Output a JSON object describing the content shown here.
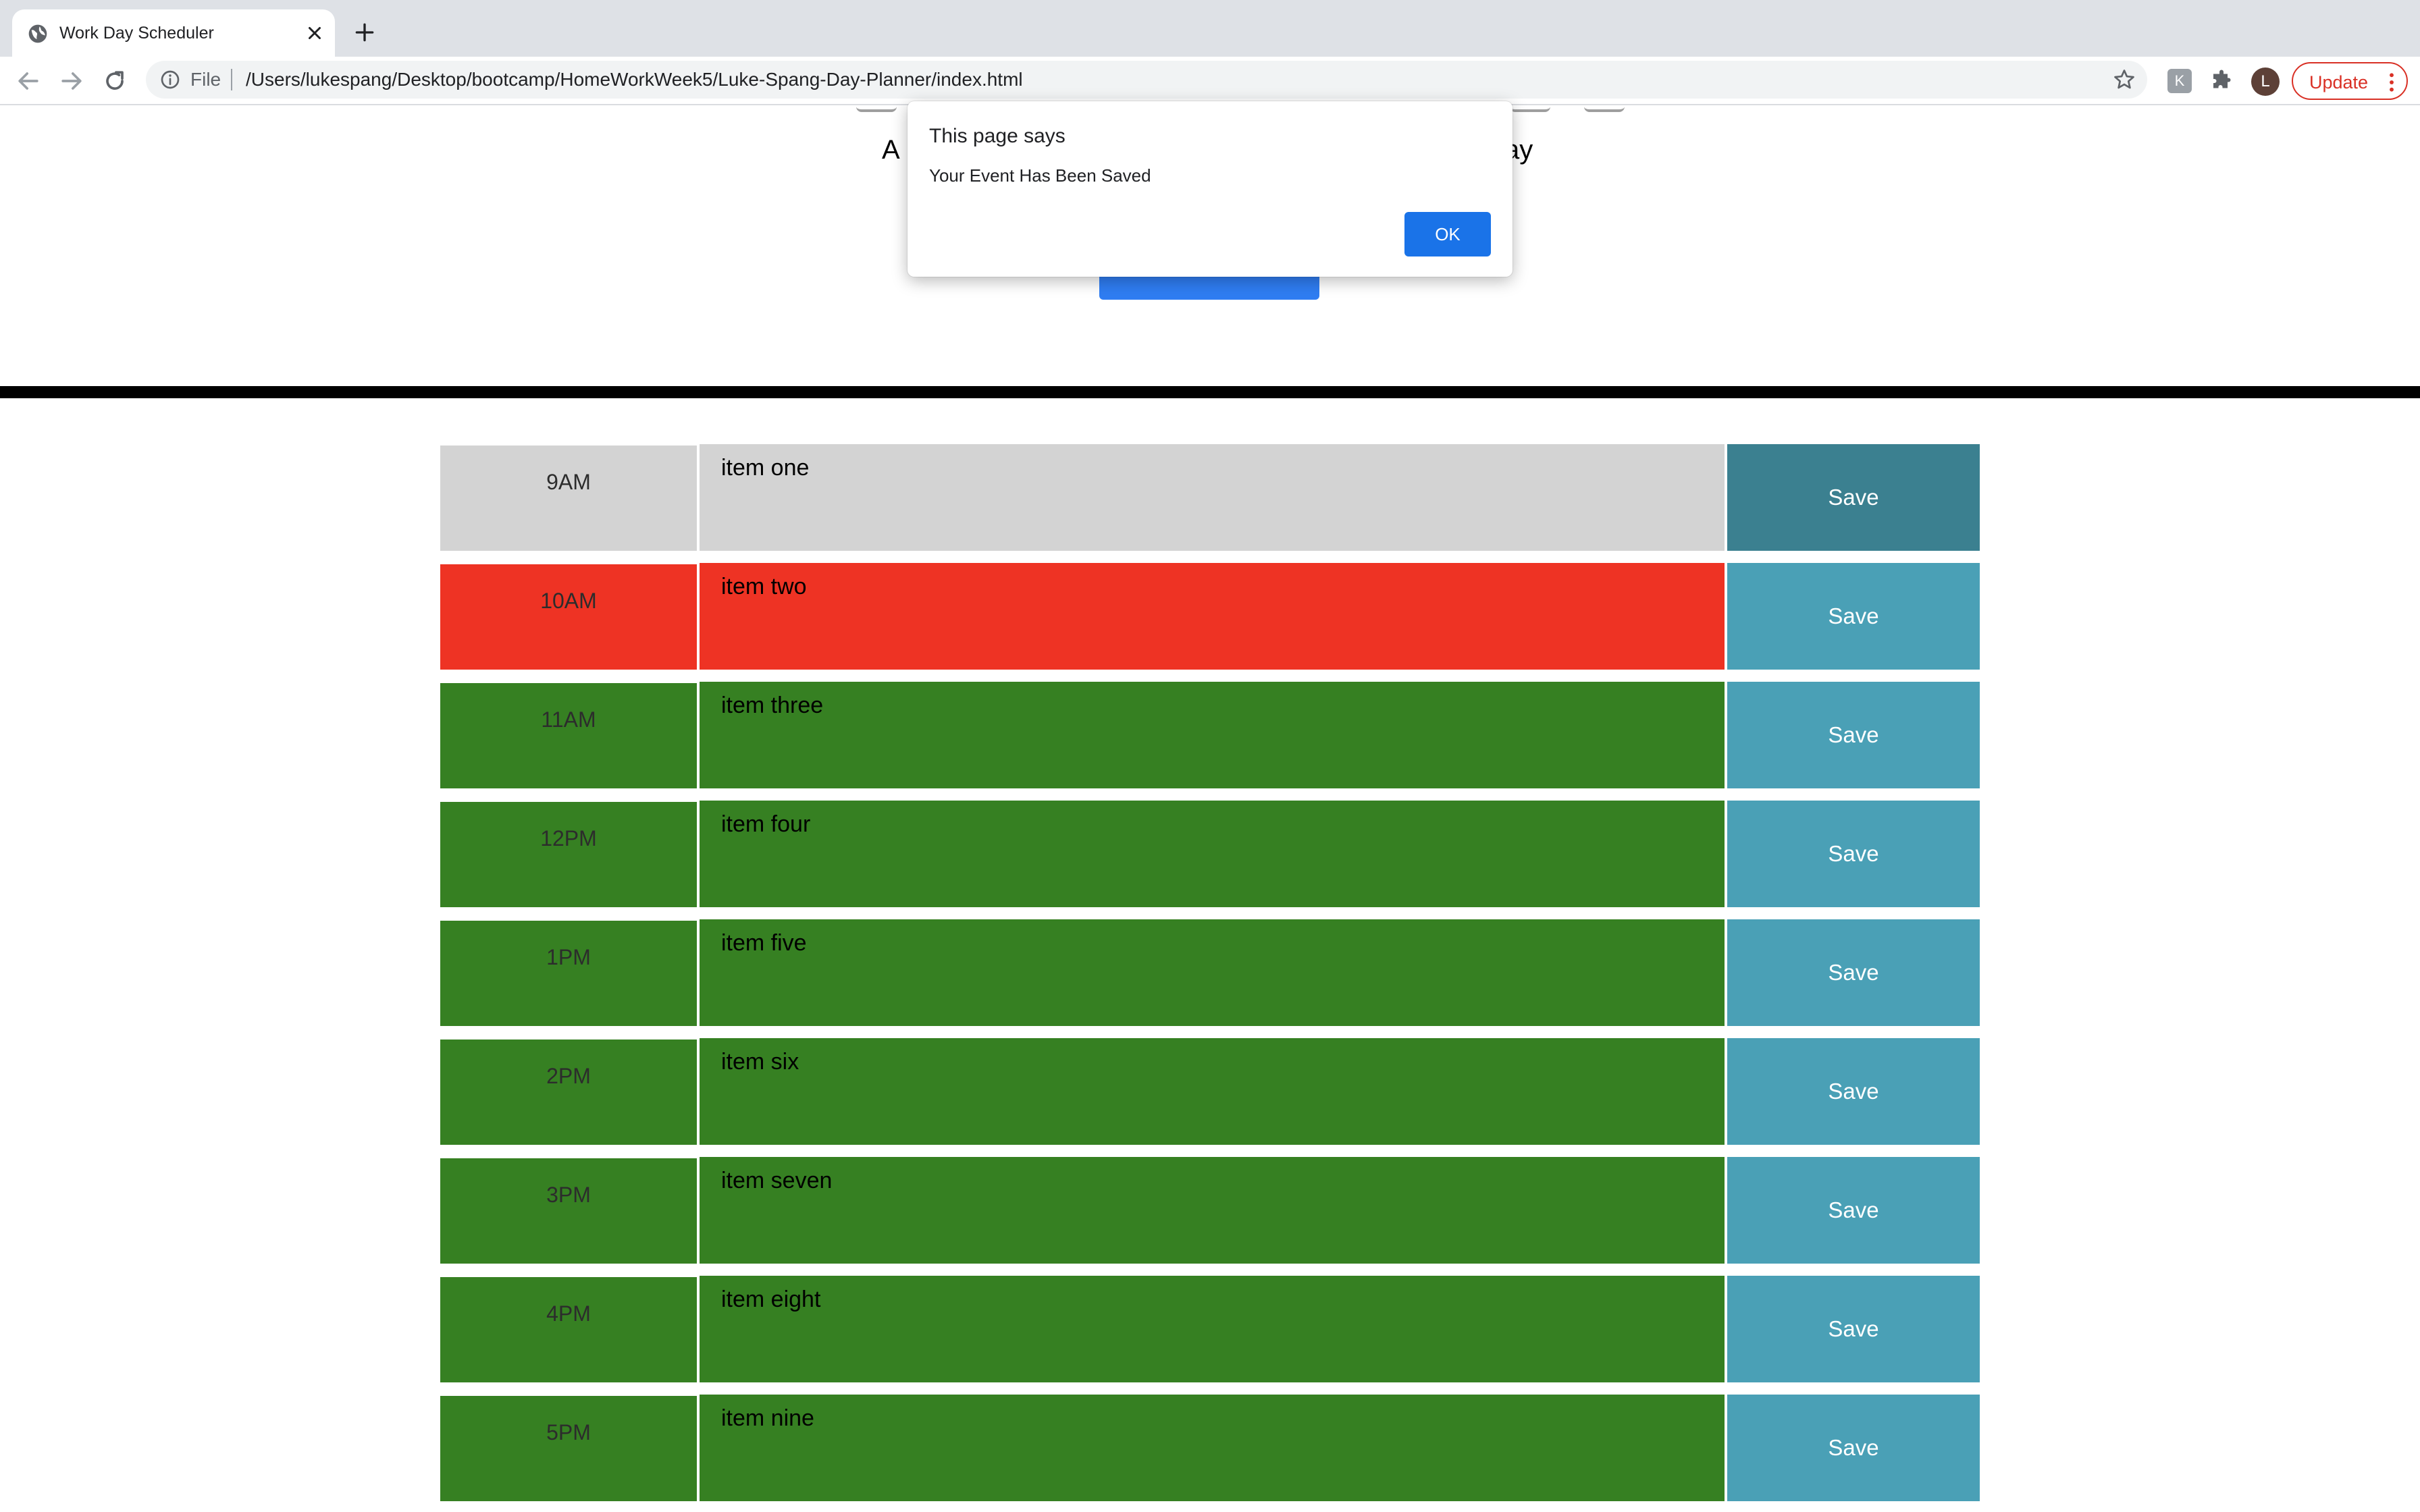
{
  "browser": {
    "tab_title": "Work Day Scheduler",
    "url_scheme": "File",
    "url_path": "/Users/lukespang/Desktop/bootcamp/HomeWorkWeek5/Luke-Spang-Day-Planner/index.html",
    "extension_badge": "K",
    "avatar_initial": "L",
    "update_label": "Update"
  },
  "header": {
    "lead_left": "A",
    "lead_right": "ay"
  },
  "dialog": {
    "title": "This page says",
    "message": "Your Event Has Been Saved",
    "ok_label": "OK"
  },
  "planner": {
    "rows": [
      {
        "hour": "9AM",
        "text": "item one",
        "state": "past",
        "save": "Save"
      },
      {
        "hour": "10AM",
        "text": "item two",
        "state": "present",
        "save": "Save"
      },
      {
        "hour": "11AM",
        "text": "item three",
        "state": "future",
        "save": "Save"
      },
      {
        "hour": "12PM",
        "text": "item four",
        "state": "future",
        "save": "Save"
      },
      {
        "hour": "1PM",
        "text": "item five",
        "state": "future",
        "save": "Save"
      },
      {
        "hour": "2PM",
        "text": "item six",
        "state": "future",
        "save": "Save"
      },
      {
        "hour": "3PM",
        "text": "item seven",
        "state": "future",
        "save": "Save"
      },
      {
        "hour": "4PM",
        "text": "item eight",
        "state": "future",
        "save": "Save"
      },
      {
        "hour": "5PM",
        "text": "item nine",
        "state": "future",
        "save": "Save"
      }
    ]
  },
  "colors": {
    "past": "#d3d3d3",
    "present": "#ee3324",
    "future": "#368022",
    "save_button": "#4aa0b6",
    "save_button_active": "#3b8090",
    "dialog_button": "#1a73e8"
  }
}
